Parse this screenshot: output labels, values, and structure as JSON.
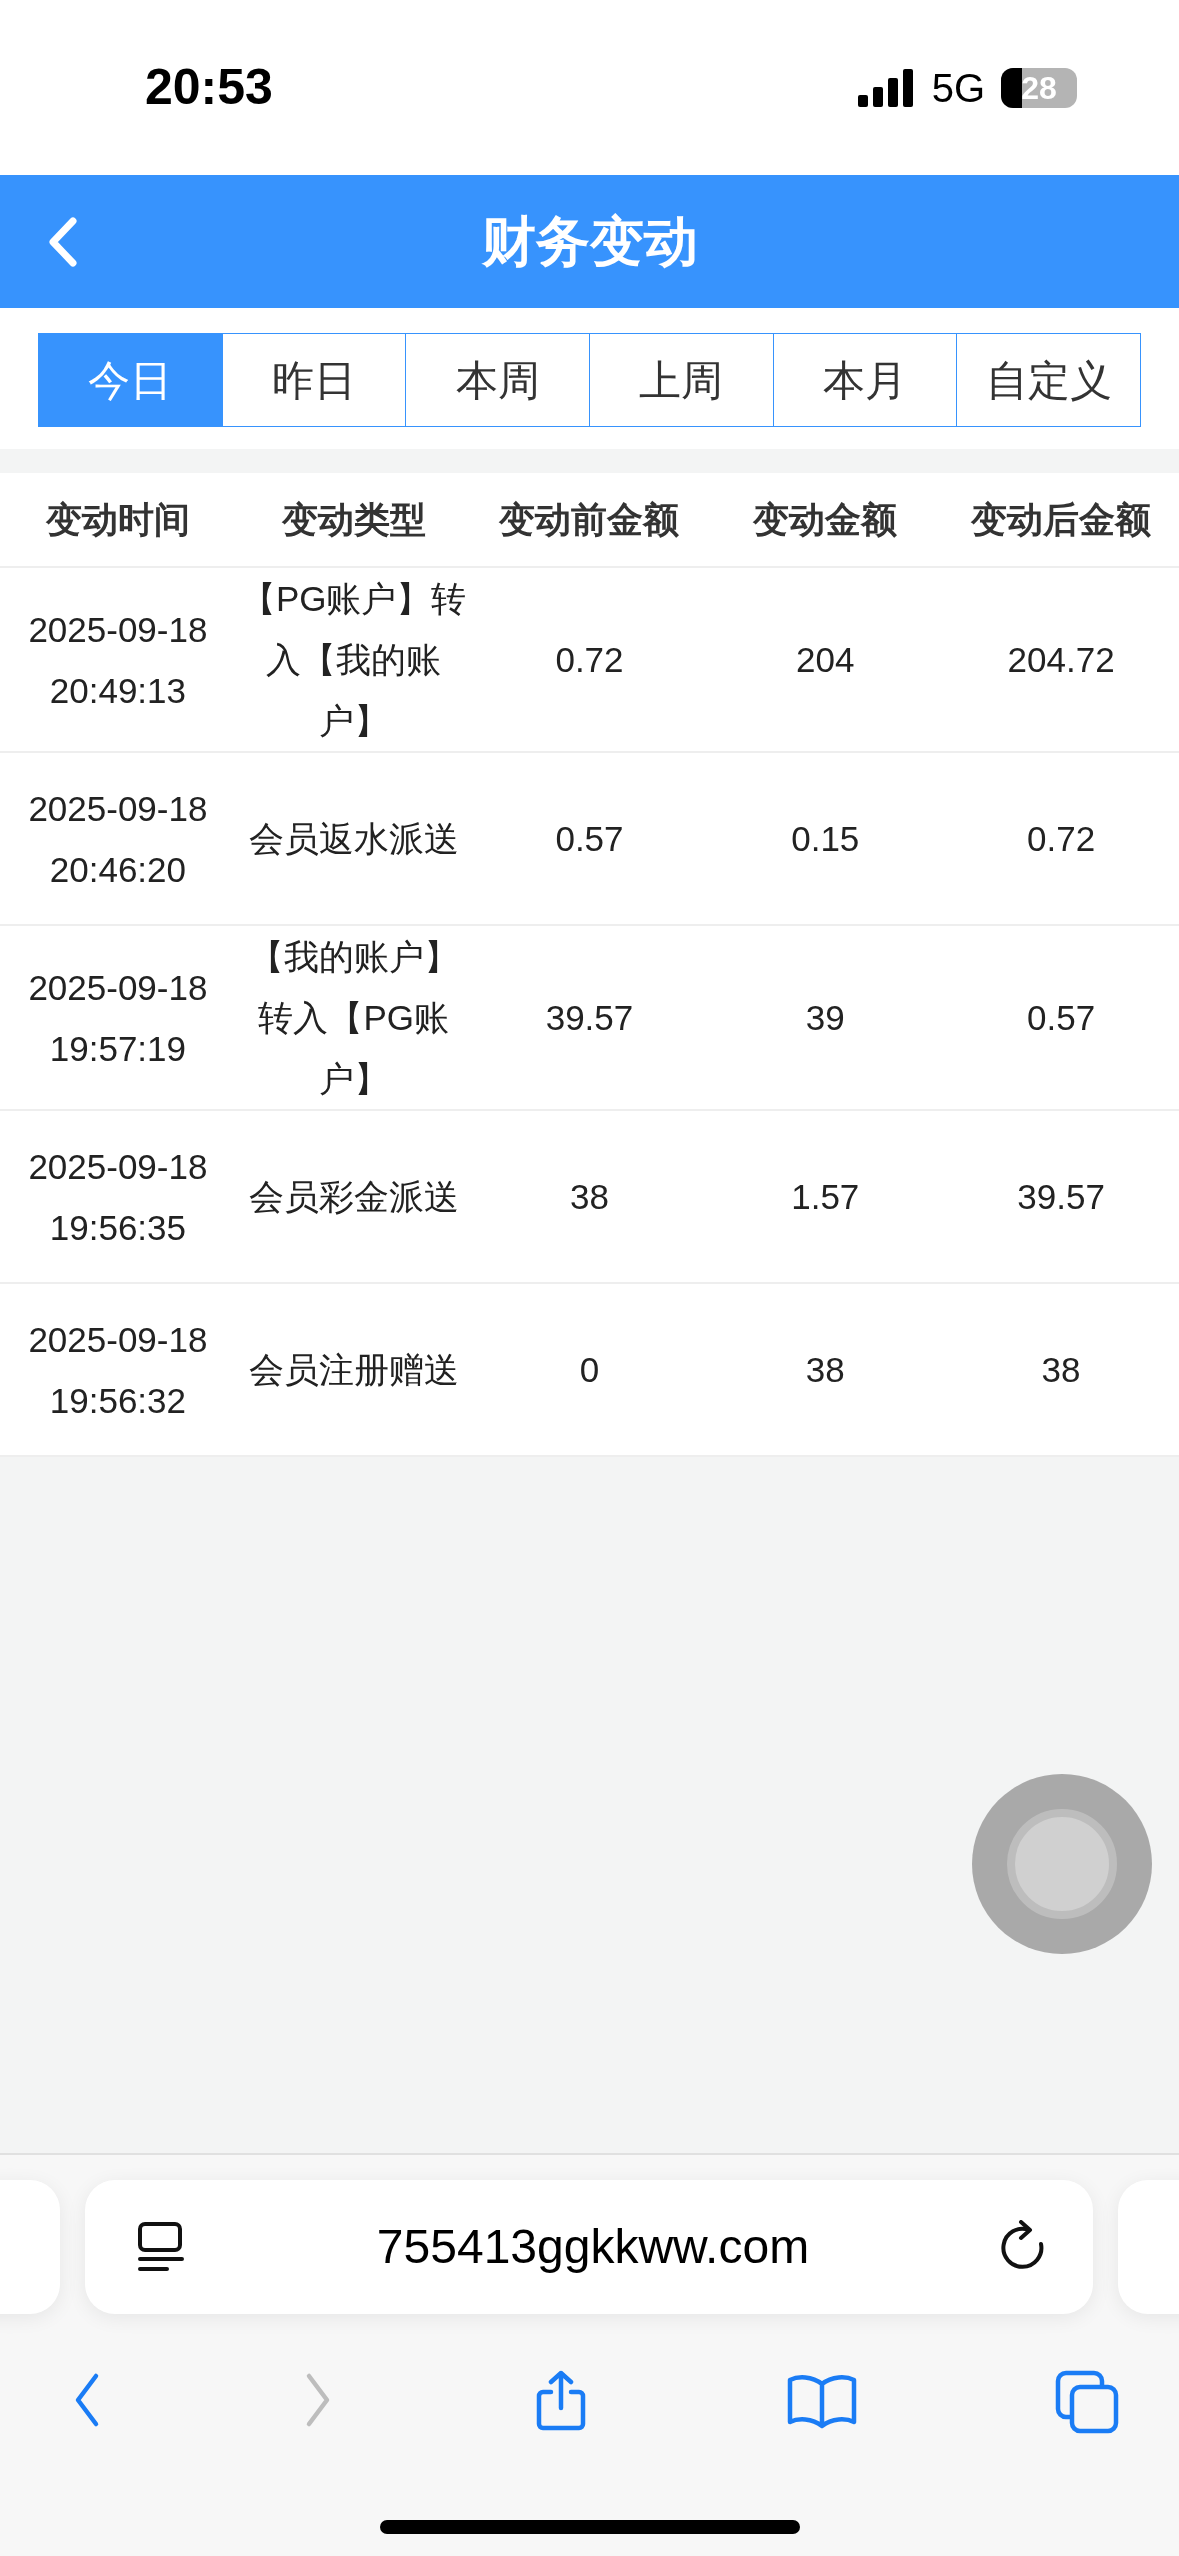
{
  "status_bar": {
    "time": "20:53",
    "network": "5G",
    "battery": "28"
  },
  "header": {
    "title": "财务变动"
  },
  "tabs": [
    {
      "label": "今日",
      "selected": true
    },
    {
      "label": "昨日",
      "selected": false
    },
    {
      "label": "本周",
      "selected": false
    },
    {
      "label": "上周",
      "selected": false
    },
    {
      "label": "本月",
      "selected": false
    },
    {
      "label": "自定义",
      "selected": false
    }
  ],
  "table": {
    "columns": [
      "变动时间",
      "变动类型",
      "变动前金额",
      "变动金额",
      "变动后金额"
    ],
    "rows": [
      {
        "date": "2025-09-18",
        "time": "20:49:13",
        "type": "【PG账户】转入【我的账户】",
        "before": "0.72",
        "amount": "204",
        "after": "204.72"
      },
      {
        "date": "2025-09-18",
        "time": "20:46:20",
        "type": "会员返水派送",
        "before": "0.57",
        "amount": "0.15",
        "after": "0.72"
      },
      {
        "date": "2025-09-18",
        "time": "19:57:19",
        "type": "【我的账户】转入【PG账户】",
        "before": "39.57",
        "amount": "39",
        "after": "0.57"
      },
      {
        "date": "2025-09-18",
        "time": "19:56:35",
        "type": "会员彩金派送",
        "before": "38",
        "amount": "1.57",
        "after": "39.57"
      },
      {
        "date": "2025-09-18",
        "time": "19:56:32",
        "type": "会员注册赠送",
        "before": "0",
        "amount": "38",
        "after": "38"
      }
    ]
  },
  "browser": {
    "url": "755413ggkkww.com",
    "toolbar": [
      {
        "kind": "back",
        "disabled": false
      },
      {
        "kind": "forward",
        "disabled": true
      },
      {
        "kind": "share",
        "disabled": false
      },
      {
        "kind": "bookmarks",
        "disabled": false
      },
      {
        "kind": "tabs",
        "disabled": false
      }
    ]
  }
}
